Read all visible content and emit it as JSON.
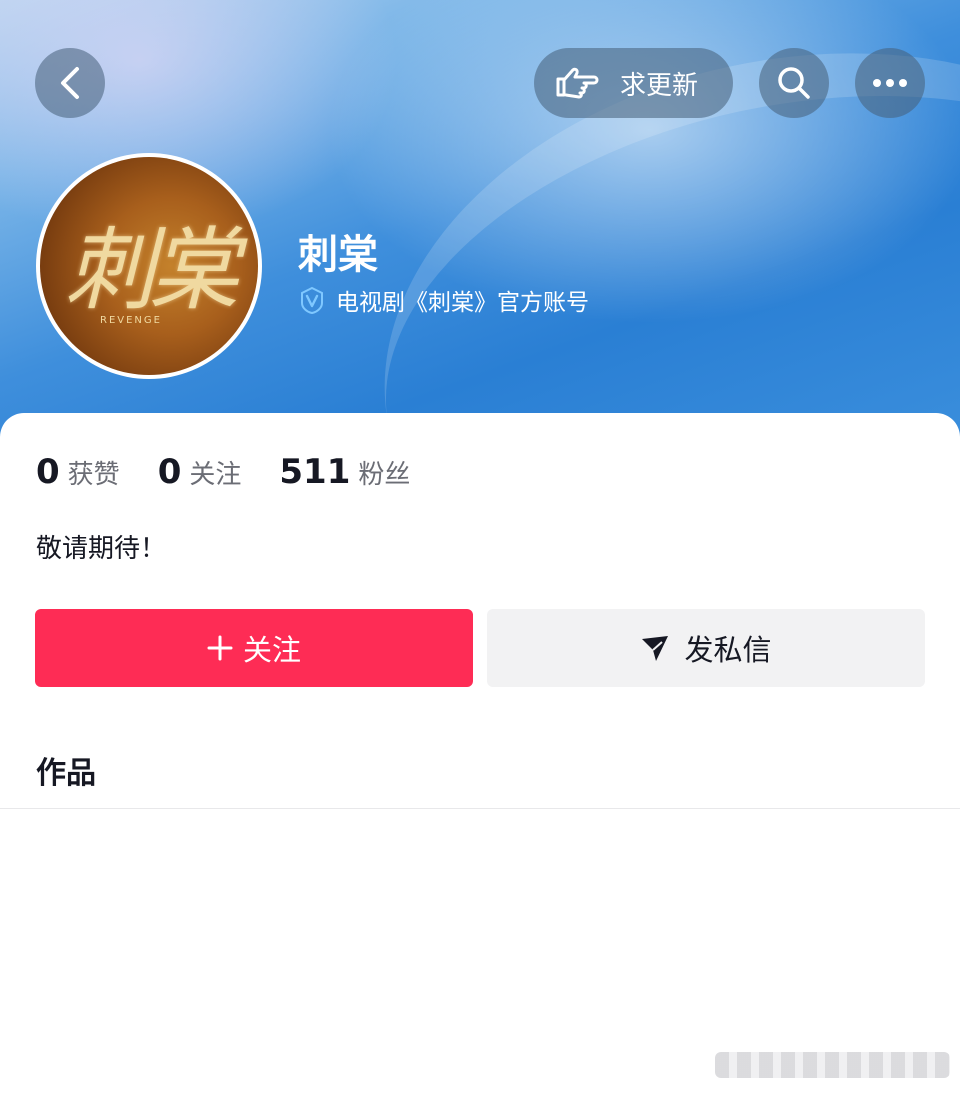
{
  "header": {
    "back_icon": "chevron-left-icon",
    "update_button_label": "求更新",
    "update_icon": "pointing-hand-icon",
    "search_icon": "search-icon",
    "more_icon": "more-icon"
  },
  "profile": {
    "name": "刺棠",
    "verified_text": "电视剧《刺棠》官方账号",
    "avatar_logo_text": "刺棠",
    "avatar_logo_sub": "REVENGE"
  },
  "stats": [
    {
      "num": "0",
      "label": "获赞"
    },
    {
      "num": "0",
      "label": "关注"
    },
    {
      "num": "511",
      "label": "粉丝"
    }
  ],
  "bio": "敬请期待！",
  "actions": {
    "follow_label": "关注",
    "message_label": "发私信"
  },
  "tabs": {
    "works_label": "作品"
  },
  "colors": {
    "follow_button": "#fe2c55",
    "message_button": "#f2f2f3",
    "banner_blue": "#2a7fd4"
  }
}
